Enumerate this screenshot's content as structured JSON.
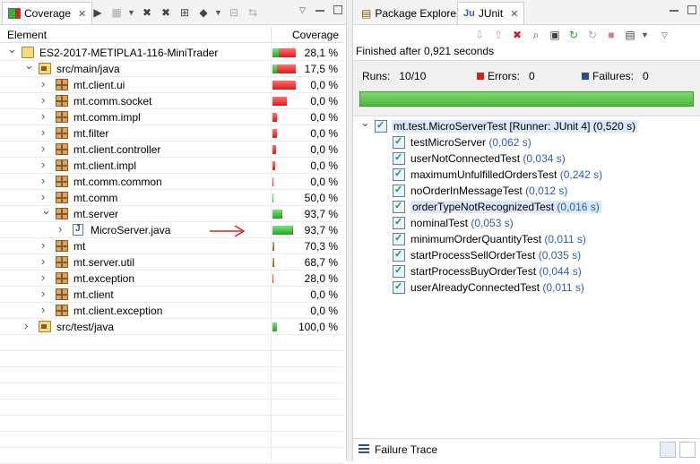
{
  "coverage": {
    "tab_label": "Coverage",
    "columns": {
      "element": "Element",
      "coverage": "Coverage"
    },
    "rows": [
      {
        "depth": 0,
        "expanded": true,
        "icon": "project-icon",
        "name": "ES2-2017-METIPLA1-116-MiniTrader",
        "pct": "28,1 %",
        "cov": 0.281
      },
      {
        "depth": 1,
        "expanded": true,
        "icon": "source-folder-icon",
        "name": "src/main/java",
        "pct": "17,5 %",
        "cov": 0.175
      },
      {
        "depth": 2,
        "expanded": false,
        "icon": "package-icon",
        "name": "mt.client.ui",
        "pct": "0,0 %",
        "cov": 0.0,
        "barw": 1.0
      },
      {
        "depth": 2,
        "expanded": false,
        "icon": "package-icon",
        "name": "mt.comm.socket",
        "pct": "0,0 %",
        "cov": 0.0,
        "barw": 0.6
      },
      {
        "depth": 2,
        "expanded": false,
        "icon": "package-icon",
        "name": "mt.comm.impl",
        "pct": "0,0 %",
        "cov": 0.0,
        "barw": 0.2
      },
      {
        "depth": 2,
        "expanded": false,
        "icon": "package-icon",
        "name": "mt.filter",
        "pct": "0,0 %",
        "cov": 0.0,
        "barw": 0.2
      },
      {
        "depth": 2,
        "expanded": false,
        "icon": "package-icon",
        "name": "mt.client.controller",
        "pct": "0,0 %",
        "cov": 0.0,
        "barw": 0.15
      },
      {
        "depth": 2,
        "expanded": false,
        "icon": "package-icon",
        "name": "mt.client.impl",
        "pct": "0,0 %",
        "cov": 0.0,
        "barw": 0.1
      },
      {
        "depth": 2,
        "expanded": false,
        "icon": "package-icon",
        "name": "mt.comm.common",
        "pct": "0,0 %",
        "cov": 0.0,
        "barw": 0.05
      },
      {
        "depth": 2,
        "expanded": false,
        "icon": "package-icon",
        "name": "mt.comm",
        "pct": "50,0 %",
        "cov": 0.5,
        "barw": 0.0
      },
      {
        "depth": 2,
        "expanded": true,
        "icon": "package-icon",
        "name": "mt.server",
        "pct": "93,7 %",
        "cov": 0.937,
        "barw": 0.4
      },
      {
        "depth": 3,
        "expanded": false,
        "icon": "java-file-icon",
        "name": "MicroServer.java",
        "pct": "93,7 %",
        "cov": 0.937,
        "barw": 0.9
      },
      {
        "depth": 2,
        "expanded": false,
        "icon": "package-icon",
        "name": "mt",
        "pct": "70,3 %",
        "cov": 0.703,
        "barw": 0.05
      },
      {
        "depth": 2,
        "expanded": false,
        "icon": "package-icon",
        "name": "mt.server.util",
        "pct": "68,7 %",
        "cov": 0.687,
        "barw": 0.05
      },
      {
        "depth": 2,
        "expanded": false,
        "icon": "package-icon",
        "name": "mt.exception",
        "pct": "28,0 %",
        "cov": 0.28,
        "barw": 0.05
      },
      {
        "depth": 2,
        "expanded": false,
        "icon": "package-icon",
        "name": "mt.client",
        "pct": "0,0 %",
        "cov": 0.0,
        "barw": 0.0
      },
      {
        "depth": 2,
        "expanded": false,
        "icon": "package-icon",
        "name": "mt.client.exception",
        "pct": "0,0 %",
        "cov": 0.0,
        "barw": 0.0
      },
      {
        "depth": 1,
        "expanded": false,
        "icon": "source-folder-icon",
        "name": "src/test/java",
        "pct": "100,0 %",
        "cov": 1.0,
        "barw": 0.2
      }
    ]
  },
  "junit": {
    "tabs": {
      "package_explorer": "Package Explorer",
      "junit": "JUnit"
    },
    "status": "Finished after 0,921 seconds",
    "runs_label": "Runs:",
    "runs_value": "10/10",
    "errors_label": "Errors:",
    "errors_value": "0",
    "failures_label": "Failures:",
    "failures_value": "0",
    "progress": 1.0,
    "suite": {
      "name": "mt.test.MicroServerTest [Runner: JUnit 4]",
      "time": "(0,520 s)"
    },
    "tests": [
      {
        "name": "testMicroServer",
        "time": "(0,062 s)"
      },
      {
        "name": "userNotConnectedTest",
        "time": "(0,034 s)"
      },
      {
        "name": "maximumUnfulfilledOrdersTest",
        "time": "(0,242 s)"
      },
      {
        "name": "noOrderInMessageTest",
        "time": "(0,012 s)"
      },
      {
        "name": "orderTypeNotRecognizedTest",
        "time": "(0,016 s)",
        "selected": true
      },
      {
        "name": "nominalTest",
        "time": "(0,053 s)"
      },
      {
        "name": "minimumOrderQuantityTest",
        "time": "(0,011 s)"
      },
      {
        "name": "startProcessSellOrderTest",
        "time": "(0,035 s)"
      },
      {
        "name": "startProcessBuyOrderTest",
        "time": "(0,044 s)"
      },
      {
        "name": "userAlreadyConnectedTest",
        "time": "(0,011 s)"
      }
    ],
    "failure_trace_label": "Failure Trace"
  },
  "colors": {
    "green": "#2eb82e",
    "red": "#e02020",
    "accent": "#2a5db0"
  }
}
